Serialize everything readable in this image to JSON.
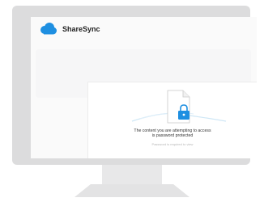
{
  "app": {
    "brand_name": "ShareSync",
    "brand_color": "#1e8fe1"
  },
  "dialog": {
    "message_line1": "The content you are attempting to access",
    "message_line2": "is password protected",
    "footnote": "Password is required to view",
    "lock_color": "#1e8fe1"
  },
  "icons": {
    "logo": "cloud-icon",
    "illustration": "locked-document-icon"
  },
  "device": {
    "frame_color": "#dcdcdd",
    "stand_color": "#e6e6e7"
  }
}
